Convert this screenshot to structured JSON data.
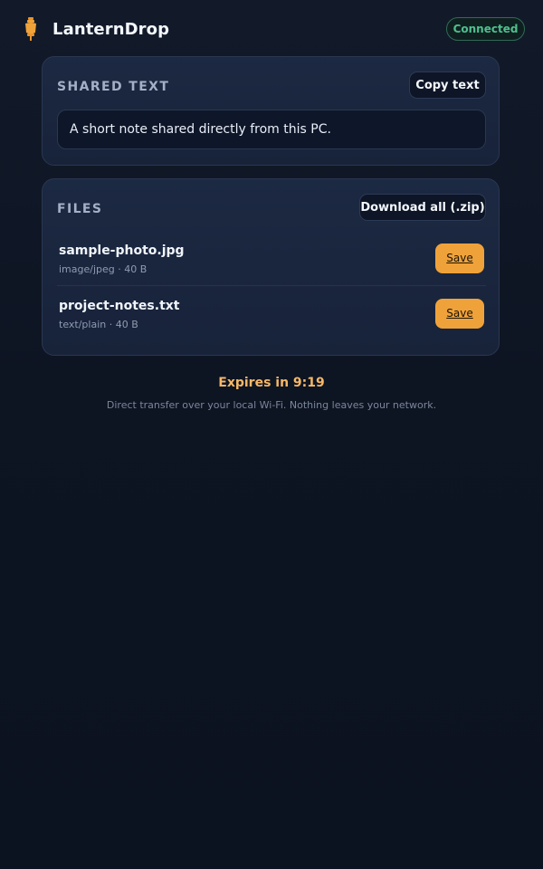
{
  "app": {
    "title": "LanternDrop",
    "status": "Connected",
    "icon": "lantern-icon"
  },
  "shared_text": {
    "title": "SHARED TEXT",
    "copy_label": "Copy text",
    "content": "A short note shared directly from this PC."
  },
  "files": {
    "title": "FILES",
    "download_all_label": "Download all (.zip)",
    "items": [
      {
        "name": "sample-photo.jpg",
        "meta": "image/jpeg · 40 B",
        "save_label": "Save"
      },
      {
        "name": "project-notes.txt",
        "meta": "text/plain · 40 B",
        "save_label": "Save"
      }
    ]
  },
  "footer": {
    "expires": "Expires in 9:19",
    "note": "Direct transfer over your local Wi-Fi. Nothing leaves your network."
  },
  "colors": {
    "accent": "#f0a23a",
    "status": "#4fc08d",
    "background": "#0b1220"
  }
}
